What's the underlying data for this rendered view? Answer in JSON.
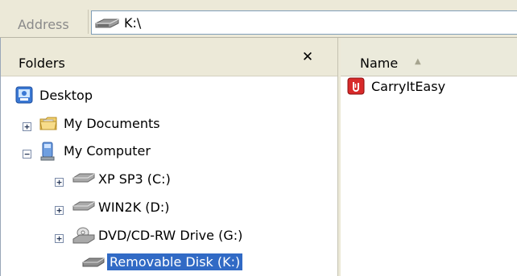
{
  "address": {
    "label": "Address",
    "value": "K:\\",
    "icon": "drive-icon"
  },
  "folders_pane": {
    "title": "Folders",
    "close_symbol": "✕",
    "tree": [
      {
        "label": "Desktop",
        "icon": "desktop-icon",
        "expander": "",
        "selected": false
      },
      {
        "label": "My Documents",
        "icon": "folder-documents-icon",
        "expander": "+",
        "selected": false
      },
      {
        "label": "My Computer",
        "icon": "computer-icon",
        "expander": "−",
        "selected": false
      },
      {
        "label": "XP SP3 (C:)",
        "icon": "hard-drive-icon",
        "expander": "+",
        "selected": false
      },
      {
        "label": "WIN2K (D:)",
        "icon": "hard-drive-icon",
        "expander": "+",
        "selected": false
      },
      {
        "label": "DVD/CD-RW Drive (G:)",
        "icon": "optical-drive-icon",
        "expander": "+",
        "selected": false
      },
      {
        "label": "Removable Disk (K:)",
        "icon": "removable-disk-icon",
        "expander": "",
        "selected": true
      }
    ]
  },
  "file_list": {
    "column_header": "Name",
    "sort_indicator": "▲",
    "items": [
      {
        "label": "CarryItEasy",
        "icon": "carryiteasy-app-icon"
      }
    ]
  },
  "colors": {
    "selection": "#316ac5",
    "window_bg": "#ece9d8"
  }
}
